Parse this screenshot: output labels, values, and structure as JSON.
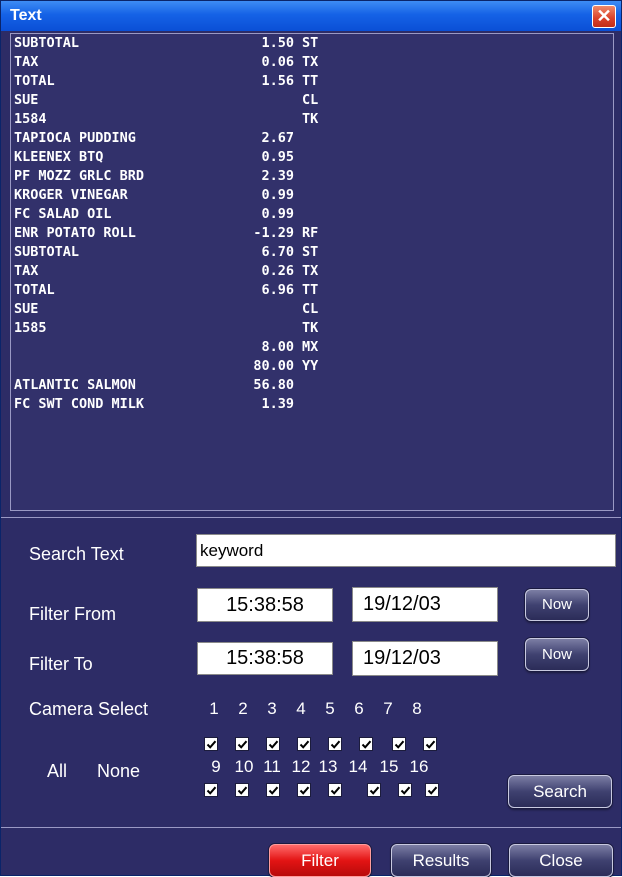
{
  "window": {
    "title": "Text",
    "close_glyph": "✕"
  },
  "receipt_lines": [
    {
      "name": "SUBTOTAL",
      "amount": "1.50",
      "code": "ST"
    },
    {
      "name": "TAX",
      "amount": "0.06",
      "code": "TX"
    },
    {
      "name": "TOTAL",
      "amount": "1.56",
      "code": "TT"
    },
    {
      "name": "SUE",
      "amount": "",
      "code": "CL"
    },
    {
      "name": "1584",
      "amount": "",
      "code": "TK"
    },
    {
      "name": "TAPIOCA PUDDING",
      "amount": "2.67",
      "code": ""
    },
    {
      "name": "KLEENEX BTQ",
      "amount": "0.95",
      "code": ""
    },
    {
      "name": "PF MOZZ GRLC BRD",
      "amount": "2.39",
      "code": ""
    },
    {
      "name": "KROGER VINEGAR",
      "amount": "0.99",
      "code": ""
    },
    {
      "name": "FC SALAD OIL",
      "amount": "0.99",
      "code": ""
    },
    {
      "name": "ENR POTATO ROLL",
      "amount": "-1.29",
      "code": "RF"
    },
    {
      "name": "SUBTOTAL",
      "amount": "6.70",
      "code": "ST"
    },
    {
      "name": "TAX",
      "amount": "0.26",
      "code": "TX"
    },
    {
      "name": "TOTAL",
      "amount": "6.96",
      "code": "TT"
    },
    {
      "name": "SUE",
      "amount": "",
      "code": "CL"
    },
    {
      "name": "1585",
      "amount": "",
      "code": "TK"
    },
    {
      "name": "",
      "amount": "8.00",
      "code": "MX"
    },
    {
      "name": "",
      "amount": "80.00",
      "code": "YY"
    },
    {
      "name": "ATLANTIC SALMON",
      "amount": "56.80",
      "code": ""
    },
    {
      "name": "FC SWT COND MILK",
      "amount": "1.39",
      "code": ""
    }
  ],
  "search": {
    "label": "Search Text",
    "value": "keyword"
  },
  "filter_from": {
    "label": "Filter From",
    "time": "15:38:58",
    "date": "19/12/03",
    "now_label": "Now"
  },
  "filter_to": {
    "label": "Filter To",
    "time": "15:38:58",
    "date": "19/12/03",
    "now_label": "Now"
  },
  "camera": {
    "label": "Camera Select",
    "top_numbers": [
      "1",
      "2",
      "3",
      "4",
      "5",
      "6",
      "7",
      "8"
    ],
    "bottom_numbers": [
      "9",
      "10",
      "11",
      "12",
      "13",
      "14",
      "15",
      "16"
    ],
    "top_checked": [
      true,
      true,
      true,
      true,
      true,
      true,
      true,
      true
    ],
    "bottom_checked": [
      true,
      true,
      true,
      true,
      true,
      true,
      true,
      true
    ],
    "all_label": "All",
    "none_label": "None"
  },
  "buttons": {
    "search": "Search",
    "filter": "Filter",
    "results": "Results",
    "close": "Close"
  },
  "colors": {
    "background": "#2d2c66",
    "titlebar": "#1562e6",
    "filter_button": "#e31414"
  }
}
